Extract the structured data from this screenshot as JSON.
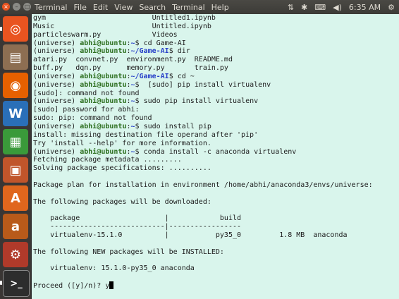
{
  "topbar": {
    "app_title": "Terminal",
    "menu": [
      "File",
      "Edit",
      "View",
      "Search",
      "Terminal",
      "Help"
    ],
    "close_glyph": "×",
    "minimize_glyph": "–",
    "maximize_glyph": "□",
    "indicators": {
      "network": "⇅",
      "bluetooth": "✱",
      "keyboard": "⌨",
      "volume": "◀)",
      "clock": "6:35 AM",
      "settings": "⚙"
    }
  },
  "launcher": [
    {
      "name": "dash-icon",
      "glyph": "◎",
      "color": "#e95420"
    },
    {
      "name": "files-icon",
      "glyph": "▤",
      "color": "#8d6e52"
    },
    {
      "name": "firefox-icon",
      "glyph": "◉",
      "color": "#e66000"
    },
    {
      "name": "libreoffice-writer-icon",
      "glyph": "W",
      "color": "#2a6fb8"
    },
    {
      "name": "libreoffice-calc-icon",
      "glyph": "▦",
      "color": "#3a9a3a"
    },
    {
      "name": "libreoffice-impress-icon",
      "glyph": "▣",
      "color": "#c0552b"
    },
    {
      "name": "software-center-icon",
      "glyph": "A",
      "color": "#e0661d"
    },
    {
      "name": "amazon-icon",
      "glyph": "a",
      "color": "#b85a1a"
    },
    {
      "name": "system-settings-icon",
      "glyph": "⚙",
      "color": "#b03a2a"
    },
    {
      "name": "terminal-icon",
      "glyph": ">_",
      "color": "#2d2d2d"
    }
  ],
  "terminal": {
    "user": "abhi@ubuntu",
    "lines": [
      {
        "t": "o",
        "text": "gym                         Untitled1.ipynb"
      },
      {
        "t": "o",
        "text": "Music                       Untitled.ipynb"
      },
      {
        "t": "o",
        "text": "particleswarm.py            Videos"
      },
      {
        "t": "p",
        "path": "~",
        "cmd": " cd Game-AI"
      },
      {
        "t": "p",
        "path": "~/Game-AI",
        "cmd": " dir"
      },
      {
        "t": "o",
        "text": "atari.py  convnet.py  environment.py  README.md"
      },
      {
        "t": "o",
        "text": "buff.py   dqn.py      memory.py       train.py"
      },
      {
        "t": "p",
        "path": "~/Game-AI",
        "cmd": " cd ~"
      },
      {
        "t": "p",
        "path": "~",
        "cmd": "  [sudo] pip install virtualenv"
      },
      {
        "t": "o",
        "text": "[sudo]: command not found"
      },
      {
        "t": "p",
        "path": "~",
        "cmd": " sudo pip install virtualenv"
      },
      {
        "t": "o",
        "text": "[sudo] password for abhi:"
      },
      {
        "t": "o",
        "text": "sudo: pip: command not found"
      },
      {
        "t": "p",
        "path": "~",
        "cmd": " sudo install pip"
      },
      {
        "t": "o",
        "text": "install: missing destination file operand after 'pip'"
      },
      {
        "t": "o",
        "text": "Try 'install --help' for more information."
      },
      {
        "t": "p",
        "path": "~",
        "cmd": " conda install -c anaconda virtualenv"
      },
      {
        "t": "o",
        "text": "Fetching package metadata ........."
      },
      {
        "t": "o",
        "text": "Solving package specifications: .........."
      },
      {
        "t": "o",
        "text": ""
      },
      {
        "t": "o",
        "text": "Package plan for installation in environment /home/abhi/anaconda3/envs/universe:"
      },
      {
        "t": "o",
        "text": ""
      },
      {
        "t": "o",
        "text": "The following packages will be downloaded:"
      },
      {
        "t": "o",
        "text": ""
      },
      {
        "t": "o",
        "text": "    package                    |            build"
      },
      {
        "t": "o",
        "text": "    ---------------------------|-----------------"
      },
      {
        "t": "o",
        "text": "    virtualenv-15.1.0          |           py35_0         1.8 MB  anaconda"
      },
      {
        "t": "o",
        "text": ""
      },
      {
        "t": "o",
        "text": "The following NEW packages will be INSTALLED:"
      },
      {
        "t": "o",
        "text": ""
      },
      {
        "t": "o",
        "text": "    virtualenv: 15.1.0-py35_0 anaconda"
      },
      {
        "t": "o",
        "text": ""
      },
      {
        "t": "c",
        "text": "Proceed ([y]/n)? y"
      }
    ]
  },
  "prompt": {
    "env": "(universe) ",
    "sep": ":",
    "dollar": "$"
  }
}
